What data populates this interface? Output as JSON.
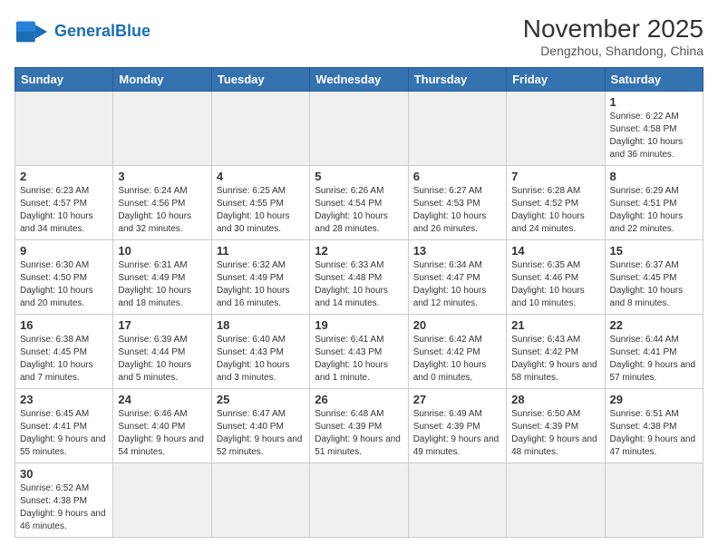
{
  "header": {
    "logo_text_normal": "General",
    "logo_text_bold": "Blue",
    "month_year": "November 2025",
    "location": "Dengzhou, Shandong, China"
  },
  "weekdays": [
    "Sunday",
    "Monday",
    "Tuesday",
    "Wednesday",
    "Thursday",
    "Friday",
    "Saturday"
  ],
  "weeks": [
    [
      {
        "day": "",
        "info": ""
      },
      {
        "day": "",
        "info": ""
      },
      {
        "day": "",
        "info": ""
      },
      {
        "day": "",
        "info": ""
      },
      {
        "day": "",
        "info": ""
      },
      {
        "day": "",
        "info": ""
      },
      {
        "day": "1",
        "info": "Sunrise: 6:22 AM\nSunset: 4:58 PM\nDaylight: 10 hours\nand 36 minutes."
      }
    ],
    [
      {
        "day": "2",
        "info": "Sunrise: 6:23 AM\nSunset: 4:57 PM\nDaylight: 10 hours\nand 34 minutes."
      },
      {
        "day": "3",
        "info": "Sunrise: 6:24 AM\nSunset: 4:56 PM\nDaylight: 10 hours\nand 32 minutes."
      },
      {
        "day": "4",
        "info": "Sunrise: 6:25 AM\nSunset: 4:55 PM\nDaylight: 10 hours\nand 30 minutes."
      },
      {
        "day": "5",
        "info": "Sunrise: 6:26 AM\nSunset: 4:54 PM\nDaylight: 10 hours\nand 28 minutes."
      },
      {
        "day": "6",
        "info": "Sunrise: 6:27 AM\nSunset: 4:53 PM\nDaylight: 10 hours\nand 26 minutes."
      },
      {
        "day": "7",
        "info": "Sunrise: 6:28 AM\nSunset: 4:52 PM\nDaylight: 10 hours\nand 24 minutes."
      },
      {
        "day": "8",
        "info": "Sunrise: 6:29 AM\nSunset: 4:51 PM\nDaylight: 10 hours\nand 22 minutes."
      }
    ],
    [
      {
        "day": "9",
        "info": "Sunrise: 6:30 AM\nSunset: 4:50 PM\nDaylight: 10 hours\nand 20 minutes."
      },
      {
        "day": "10",
        "info": "Sunrise: 6:31 AM\nSunset: 4:49 PM\nDaylight: 10 hours\nand 18 minutes."
      },
      {
        "day": "11",
        "info": "Sunrise: 6:32 AM\nSunset: 4:49 PM\nDaylight: 10 hours\nand 16 minutes."
      },
      {
        "day": "12",
        "info": "Sunrise: 6:33 AM\nSunset: 4:48 PM\nDaylight: 10 hours\nand 14 minutes."
      },
      {
        "day": "13",
        "info": "Sunrise: 6:34 AM\nSunset: 4:47 PM\nDaylight: 10 hours\nand 12 minutes."
      },
      {
        "day": "14",
        "info": "Sunrise: 6:35 AM\nSunset: 4:46 PM\nDaylight: 10 hours\nand 10 minutes."
      },
      {
        "day": "15",
        "info": "Sunrise: 6:37 AM\nSunset: 4:45 PM\nDaylight: 10 hours\nand 8 minutes."
      }
    ],
    [
      {
        "day": "16",
        "info": "Sunrise: 6:38 AM\nSunset: 4:45 PM\nDaylight: 10 hours\nand 7 minutes."
      },
      {
        "day": "17",
        "info": "Sunrise: 6:39 AM\nSunset: 4:44 PM\nDaylight: 10 hours\nand 5 minutes."
      },
      {
        "day": "18",
        "info": "Sunrise: 6:40 AM\nSunset: 4:43 PM\nDaylight: 10 hours\nand 3 minutes."
      },
      {
        "day": "19",
        "info": "Sunrise: 6:41 AM\nSunset: 4:43 PM\nDaylight: 10 hours\nand 1 minute."
      },
      {
        "day": "20",
        "info": "Sunrise: 6:42 AM\nSunset: 4:42 PM\nDaylight: 10 hours\nand 0 minutes."
      },
      {
        "day": "21",
        "info": "Sunrise: 6:43 AM\nSunset: 4:42 PM\nDaylight: 9 hours\nand 58 minutes."
      },
      {
        "day": "22",
        "info": "Sunrise: 6:44 AM\nSunset: 4:41 PM\nDaylight: 9 hours\nand 57 minutes."
      }
    ],
    [
      {
        "day": "23",
        "info": "Sunrise: 6:45 AM\nSunset: 4:41 PM\nDaylight: 9 hours\nand 55 minutes."
      },
      {
        "day": "24",
        "info": "Sunrise: 6:46 AM\nSunset: 4:40 PM\nDaylight: 9 hours\nand 54 minutes."
      },
      {
        "day": "25",
        "info": "Sunrise: 6:47 AM\nSunset: 4:40 PM\nDaylight: 9 hours\nand 52 minutes."
      },
      {
        "day": "26",
        "info": "Sunrise: 6:48 AM\nSunset: 4:39 PM\nDaylight: 9 hours\nand 51 minutes."
      },
      {
        "day": "27",
        "info": "Sunrise: 6:49 AM\nSunset: 4:39 PM\nDaylight: 9 hours\nand 49 minutes."
      },
      {
        "day": "28",
        "info": "Sunrise: 6:50 AM\nSunset: 4:39 PM\nDaylight: 9 hours\nand 48 minutes."
      },
      {
        "day": "29",
        "info": "Sunrise: 6:51 AM\nSunset: 4:38 PM\nDaylight: 9 hours\nand 47 minutes."
      }
    ],
    [
      {
        "day": "30",
        "info": "Sunrise: 6:52 AM\nSunset: 4:38 PM\nDaylight: 9 hours\nand 46 minutes."
      },
      {
        "day": "",
        "info": ""
      },
      {
        "day": "",
        "info": ""
      },
      {
        "day": "",
        "info": ""
      },
      {
        "day": "",
        "info": ""
      },
      {
        "day": "",
        "info": ""
      },
      {
        "day": "",
        "info": ""
      }
    ]
  ]
}
